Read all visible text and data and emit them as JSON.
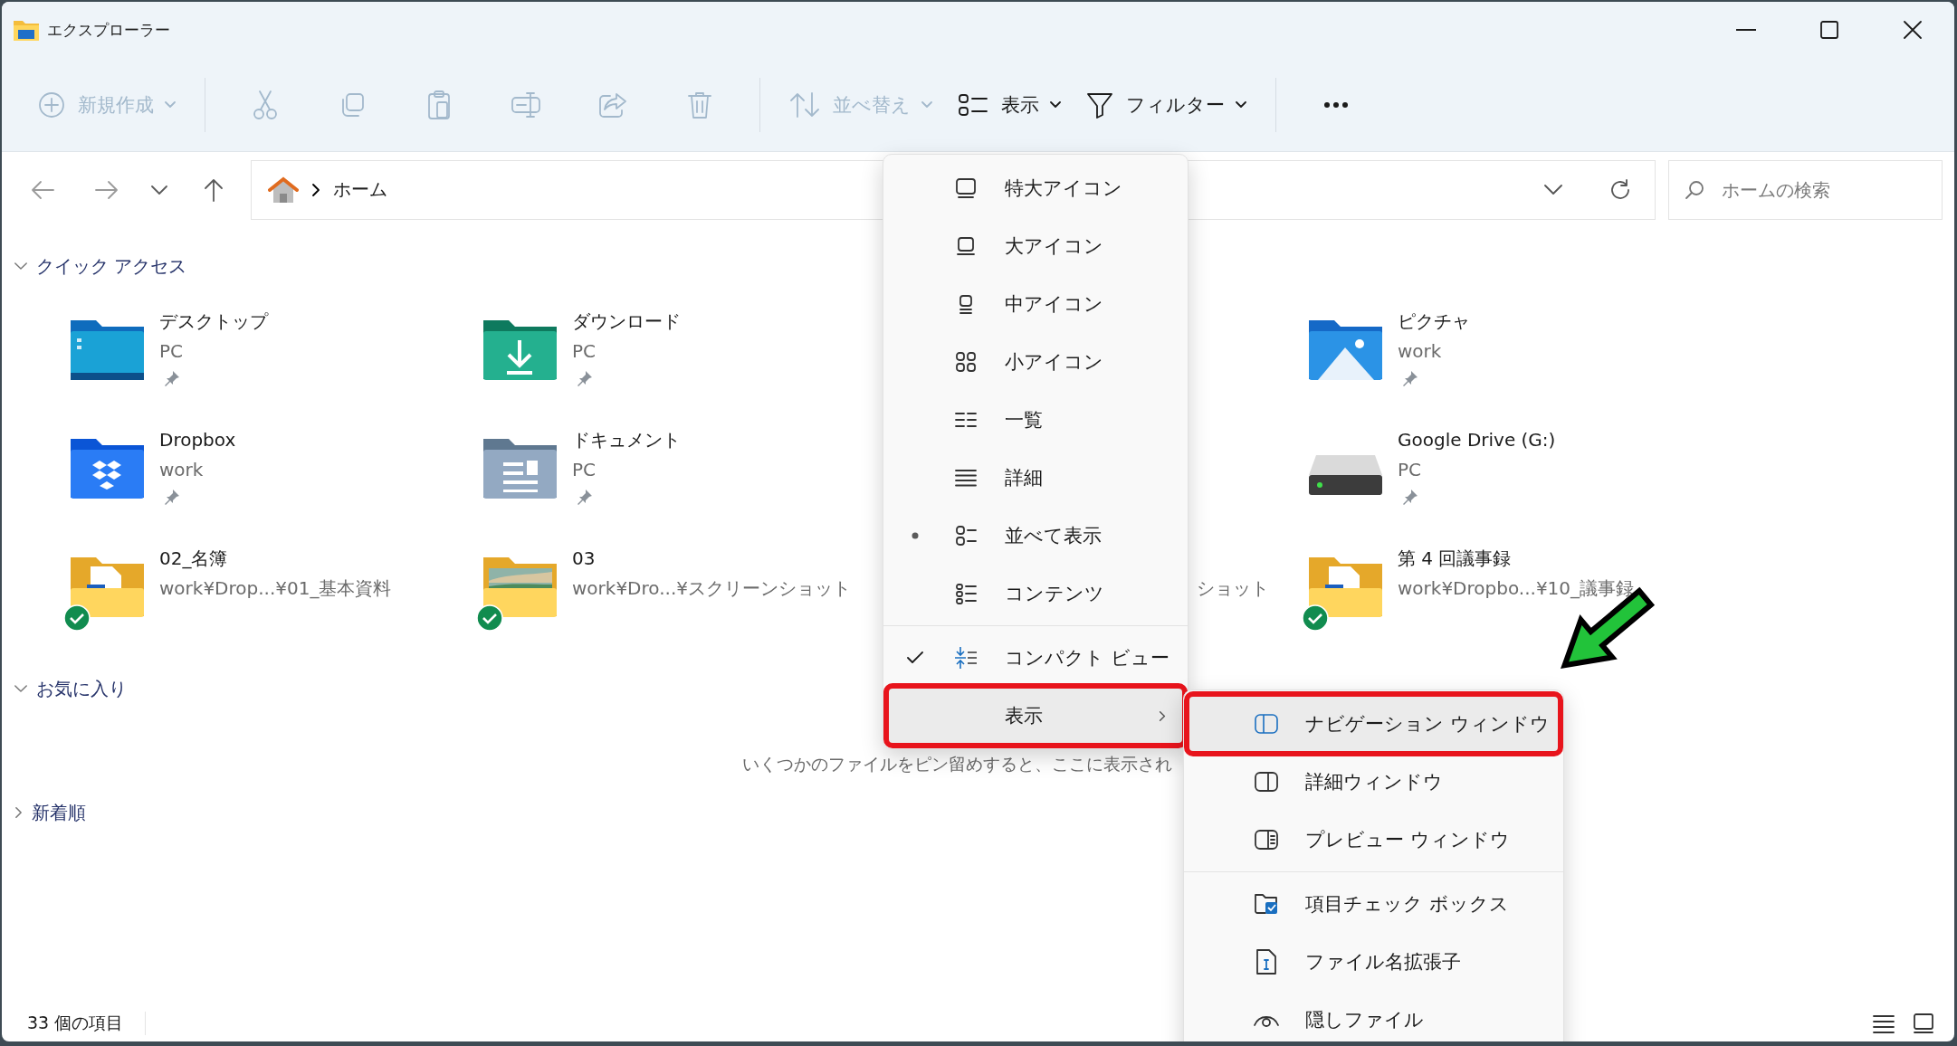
{
  "window": {
    "title": "エクスプローラー"
  },
  "toolbar": [
    {
      "kind": "button",
      "label": "新規作成",
      "disabled": true
    },
    {
      "kind": "separator"
    },
    {
      "kind": "icon",
      "disabled": true
    },
    {
      "kind": "icon",
      "disabled": true
    },
    {
      "kind": "icon",
      "disabled": true
    },
    {
      "kind": "icon",
      "disabled": true
    },
    {
      "kind": "icon",
      "disabled": true
    },
    {
      "kind": "icon",
      "disabled": true
    },
    {
      "kind": "separator"
    },
    {
      "kind": "button",
      "label": "並べ替え",
      "disabled": true
    },
    {
      "kind": "button",
      "label": "表示",
      "disabled": false
    },
    {
      "kind": "button",
      "label": "フィルター",
      "disabled": false
    },
    {
      "kind": "separator"
    },
    {
      "kind": "icon",
      "disabled": false
    }
  ],
  "navigation": [
    {
      "disabled": true
    },
    {
      "disabled": true
    },
    {
      "disabled": false
    },
    {
      "disabled": false
    }
  ],
  "address": {
    "crumbs": [
      "ホーム"
    ]
  },
  "search": {
    "placeholder": "ホームの検索"
  },
  "sections": [
    {
      "title": "クイック アクセス",
      "expanded": true,
      "rows": [
        [
          {
            "kind": "tile",
            "name": "デスクトップ",
            "location": "PC",
            "pinned": true,
            "synced": false
          },
          {
            "kind": "tile",
            "name": "ダウンロード",
            "location": "PC",
            "pinned": true,
            "synced": false
          },
          null,
          {
            "kind": "tile",
            "name": "ピクチャ",
            "location": "work",
            "pinned": true,
            "synced": false
          }
        ],
        [
          {
            "kind": "tile",
            "name": "Dropbox",
            "location": "work",
            "pinned": true,
            "synced": false
          },
          {
            "kind": "tile",
            "name": "ドキュメント",
            "location": "PC",
            "pinned": true,
            "synced": false
          },
          null,
          {
            "kind": "tile",
            "name": "Google Drive (G:)",
            "location": "PC",
            "pinned": true,
            "synced": false
          }
        ],
        [
          {
            "kind": "tile",
            "name": "02_名簿",
            "location": "work¥Drop...¥01_基本資料",
            "pinned": false,
            "synced": true
          },
          {
            "kind": "tile",
            "name": "03",
            "location": "work¥Dro...¥スクリーンショット",
            "pinned": false,
            "synced": true
          },
          {
            "kind": "partial",
            "location": "ショット"
          },
          {
            "kind": "tile",
            "name": "第 4 回議事録",
            "location": "work¥Dropbo...¥10_議事録",
            "pinned": false,
            "synced": true
          }
        ]
      ]
    },
    {
      "title": "お気に入り",
      "expanded": true,
      "empty_message": "いくつかのファイルをピン留めすると、ここに表示され"
    },
    {
      "title": "新着順",
      "expanded": false
    }
  ],
  "view_menu": {
    "items": [
      {
        "kind": "radio",
        "label": "特大アイコン",
        "selected": false
      },
      {
        "kind": "radio",
        "label": "大アイコン",
        "selected": false
      },
      {
        "kind": "radio",
        "label": "中アイコン",
        "selected": false
      },
      {
        "kind": "radio",
        "label": "小アイコン",
        "selected": false
      },
      {
        "kind": "radio",
        "label": "一覧",
        "selected": false
      },
      {
        "kind": "radio",
        "label": "詳細",
        "selected": false
      },
      {
        "kind": "radio",
        "label": "並べて表示",
        "selected": true
      },
      {
        "kind": "radio",
        "label": "コンテンツ",
        "selected": false
      },
      {
        "kind": "separator"
      },
      {
        "kind": "toggle",
        "label": "コンパクト ビュー",
        "checked": true
      },
      {
        "kind": "submenu",
        "label": "表示",
        "highlighted": true,
        "outlined": true
      }
    ]
  },
  "show_submenu": {
    "items": [
      {
        "kind": "item",
        "label": "ナビゲーション ウィンドウ",
        "highlighted": true,
        "outlined": true
      },
      {
        "kind": "item",
        "label": "詳細ウィンドウ",
        "highlighted": false,
        "outlined": false
      },
      {
        "kind": "item",
        "label": "プレビュー ウィンドウ",
        "highlighted": false,
        "outlined": false
      },
      {
        "kind": "separator"
      },
      {
        "kind": "item",
        "label": "項目チェック ボックス",
        "highlighted": false,
        "outlined": false
      },
      {
        "kind": "item",
        "label": "ファイル名拡張子",
        "highlighted": false,
        "outlined": false
      },
      {
        "kind": "item",
        "label": "隠しファイル",
        "highlighted": false,
        "outlined": false
      }
    ]
  },
  "annotation": {
    "kind": "arrow"
  },
  "status_bar": {
    "count": "33 個の項目"
  }
}
